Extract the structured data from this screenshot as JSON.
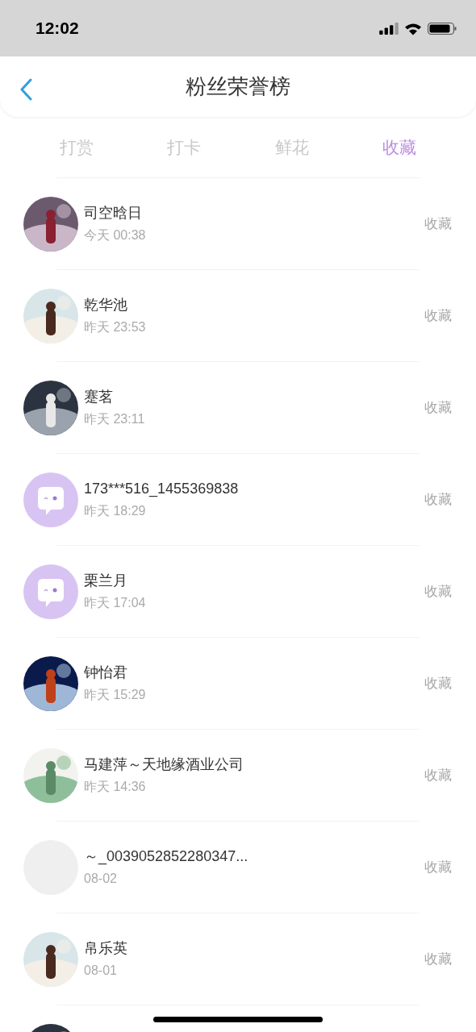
{
  "status_bar": {
    "time": "12:02"
  },
  "nav": {
    "title": "粉丝荣誉榜"
  },
  "tabs": [
    {
      "label": "打赏",
      "selected": false
    },
    {
      "label": "打卡",
      "selected": false
    },
    {
      "label": "鲜花",
      "selected": false
    },
    {
      "label": "收藏",
      "selected": true
    }
  ],
  "rows": [
    {
      "kind": "picture",
      "name": "司空晗日",
      "time": "今天 00:38",
      "action": "收藏"
    },
    {
      "kind": "picture",
      "name": "乾华池",
      "time": "昨天 23:53",
      "action": "收藏"
    },
    {
      "kind": "picture",
      "name": "蹇茗",
      "time": "昨天 23:11",
      "action": "收藏"
    },
    {
      "kind": "default",
      "name": "173***516_1455369838",
      "time": "昨天 18:29",
      "action": "收藏"
    },
    {
      "kind": "default",
      "name": "栗兰月",
      "time": "昨天 17:04",
      "action": "收藏"
    },
    {
      "kind": "picture",
      "name": "钟怡君",
      "time": "昨天 15:29",
      "action": "收藏"
    },
    {
      "kind": "picture",
      "name": "马建萍～天地缘酒业公司",
      "time": "昨天 14:36",
      "action": "收藏"
    },
    {
      "kind": "blank",
      "name": "～_0039052852280347...",
      "time": "08-02",
      "action": "收藏"
    },
    {
      "kind": "picture",
      "name": "帛乐英",
      "time": "08-01",
      "action": "收藏"
    },
    {
      "kind": "picture"
    }
  ]
}
